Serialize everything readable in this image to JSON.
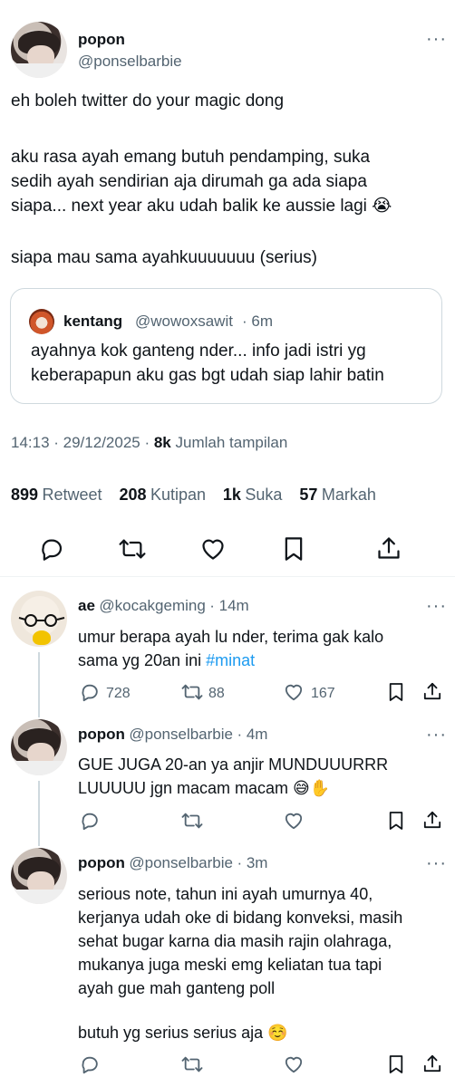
{
  "main_tweet": {
    "name": "popon",
    "handle": "@ponselbarbie",
    "lines": [
      "eh boleh twitter do your magic dong",
      "aku rasa ayah emang butuh pendamping, suka",
      "sedih ayah sendirian aja dirumah ga ada siapa",
      "siapa... next year aku udah balik ke aussie lagi 😭",
      "siapa mau sama ayahkuuuuuuu (serius)"
    ],
    "quote": {
      "name": "kentang",
      "handle": "@wowoxsawit",
      "time": "· 6m",
      "lines": [
        "ayahnya kok ganteng nder... info jadi istri yg",
        "keberapapun aku gas bgt udah siap lahir batin"
      ]
    },
    "timestamp": "14:13 · 29/12/2025 · ",
    "views_count": "8k",
    "views_label": "Jumlah tampilan",
    "stats": {
      "retweets": "899",
      "retweets_label": "Retweet",
      "quotes": "208",
      "quotes_label": "Kutipan",
      "likes": "1k",
      "likes_label": "Suka",
      "bookmarks": "57",
      "bookmarks_label": "Markah"
    }
  },
  "replies": [
    {
      "name": "ae",
      "handle": "@kocakgeming",
      "time": "· 14m",
      "lines": [
        "umur berapa ayah lu nder, terima gak kalo",
        "sama yg 20an ini "
      ],
      "hashtag": "#minat",
      "reply_count": "728",
      "retweet_count": "88",
      "like_count": "167"
    },
    {
      "name": "popon",
      "handle": "@ponselbarbie",
      "time": "· 4m",
      "lines": [
        "GUE JUGA 20-an ya anjir MUNDUUURRR",
        "LUUUUU jgn macam macam 😅✋"
      ]
    },
    {
      "name": "popon",
      "handle": "@ponselbarbie",
      "time": "· 3m",
      "lines": [
        "serious note, tahun ini ayah umurnya 40,",
        "kerjanya udah oke di bidang konveksi, masih",
        "sehat bugar karna dia masih rajin olahraga,",
        "mukanya juga meski emg keliatan tua tapi",
        "ayah gue mah ganteng poll",
        "butuh yg serius serius aja ☺️"
      ]
    }
  ],
  "colors": {
    "text": "#0f1419",
    "muted": "#536471",
    "accent": "#1d9bf0",
    "border": "#cfd9de"
  },
  "icons": [
    "more-icon",
    "reply-icon",
    "retweet-icon",
    "like-icon",
    "bookmark-icon",
    "share-icon"
  ]
}
